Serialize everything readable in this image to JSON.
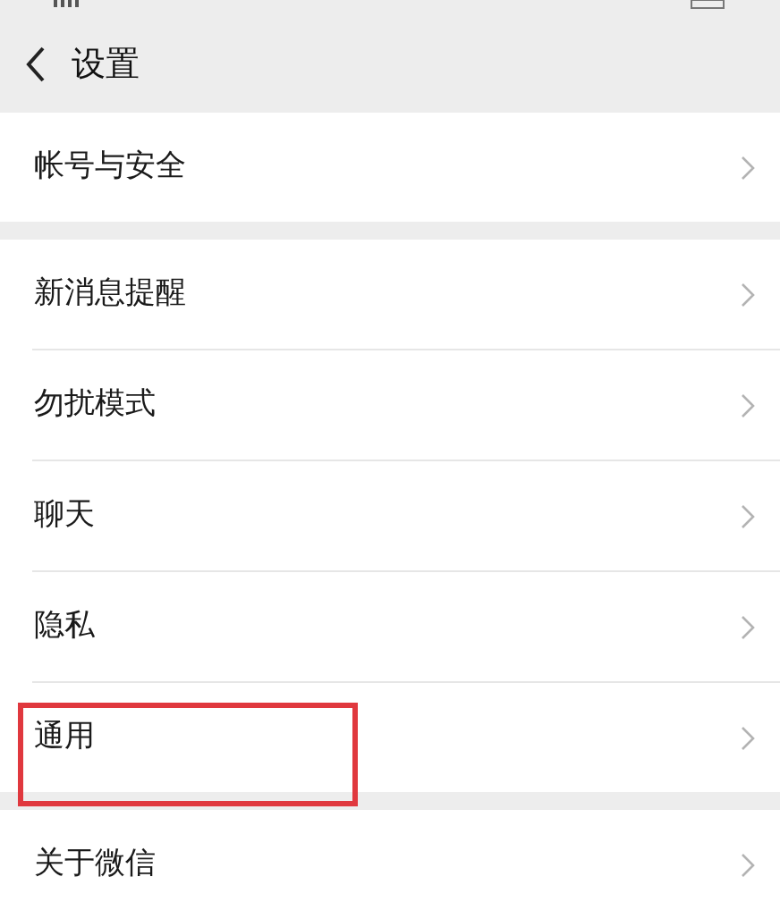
{
  "header": {
    "title": "设置"
  },
  "groups": [
    {
      "items": [
        {
          "label": "帐号与安全",
          "highlighted": false
        }
      ]
    },
    {
      "items": [
        {
          "label": "新消息提醒",
          "highlighted": false
        },
        {
          "label": "勿扰模式",
          "highlighted": false
        },
        {
          "label": "聊天",
          "highlighted": false
        },
        {
          "label": "隐私",
          "highlighted": false
        },
        {
          "label": "通用",
          "highlighted": true
        }
      ]
    },
    {
      "items": [
        {
          "label": "关于微信",
          "highlighted": false
        }
      ]
    }
  ]
}
